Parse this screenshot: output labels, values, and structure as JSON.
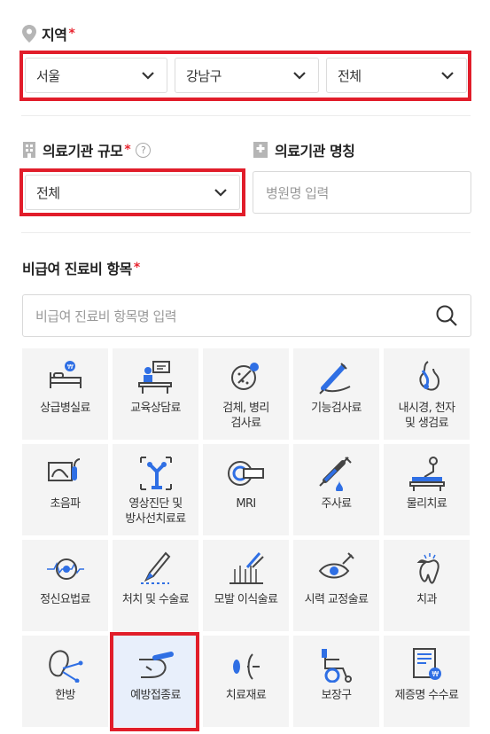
{
  "region": {
    "label": "지역",
    "required_mark": "*",
    "city": "서울",
    "district": "강남구",
    "dong": "전체"
  },
  "scale": {
    "label": "의료기관 규모",
    "required_mark": "*",
    "help": "?",
    "value": "전체"
  },
  "name": {
    "label": "의료기관 명칭",
    "placeholder": "병원명 입력"
  },
  "items": {
    "label": "비급여 진료비 항목",
    "required_mark": "*",
    "search_placeholder": "비급여 진료비 항목명 입력",
    "tiles": [
      {
        "label": "상급병실료",
        "icon": "hospital-bed-icon"
      },
      {
        "label": "교육상담료",
        "icon": "counseling-icon"
      },
      {
        "label": "검체, 병리\n검사료",
        "icon": "pathology-icon"
      },
      {
        "label": "기능검사료",
        "icon": "function-test-icon"
      },
      {
        "label": "내시경, 천자\n및 생검료",
        "icon": "endoscopy-icon"
      },
      {
        "label": "초음파",
        "icon": "ultrasound-icon"
      },
      {
        "label": "영상진단 및\n방사선치료료",
        "icon": "radiology-icon"
      },
      {
        "label": "MRI",
        "icon": "mri-icon"
      },
      {
        "label": "주사료",
        "icon": "syringe-icon"
      },
      {
        "label": "물리치료",
        "icon": "physical-therapy-icon"
      },
      {
        "label": "정신요법료",
        "icon": "brain-icon"
      },
      {
        "label": "처치 및 수술료",
        "icon": "scalpel-icon"
      },
      {
        "label": "모발 이식술료",
        "icon": "hair-transplant-icon"
      },
      {
        "label": "시력 교정술료",
        "icon": "eye-surgery-icon"
      },
      {
        "label": "치과",
        "icon": "tooth-icon"
      },
      {
        "label": "한방",
        "icon": "acupuncture-icon"
      },
      {
        "label": "예방접종료",
        "icon": "vaccination-icon"
      },
      {
        "label": "치료재료",
        "icon": "treatment-material-icon"
      },
      {
        "label": "보장구",
        "icon": "wheelchair-icon"
      },
      {
        "label": "제증명 수수료",
        "icon": "certificate-icon"
      }
    ],
    "selected_index": 16
  },
  "colors": {
    "accent_red": "#e11d2a",
    "icon_blue": "#2f6fe4",
    "selected_tile_bg": "#e8effb"
  }
}
